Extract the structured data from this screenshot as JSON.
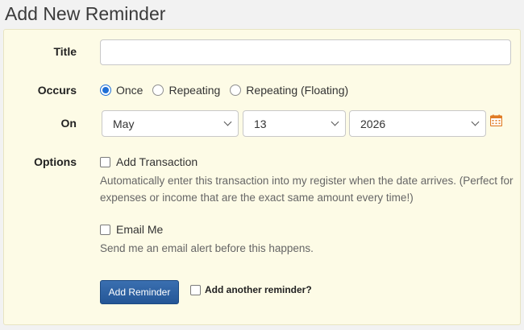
{
  "page": {
    "title": "Add New Reminder"
  },
  "form": {
    "title": {
      "label": "Title",
      "value": "",
      "placeholder": ""
    },
    "occurs": {
      "label": "Occurs",
      "options": [
        "Once",
        "Repeating",
        "Repeating (Floating)"
      ],
      "selected": "Once"
    },
    "on": {
      "label": "On",
      "month": "May",
      "day": "13",
      "year": "2026",
      "calendar_icon": "calendar-icon"
    },
    "options": {
      "label": "Options",
      "add_transaction": {
        "label": "Add Transaction",
        "checked": false,
        "help": "Automatically enter this transaction into my register when the date arrives. (Perfect for expenses or income that are the exact same amount every time!)"
      },
      "email_me": {
        "label": "Email Me",
        "checked": false,
        "help": "Send me an email alert before this happens."
      }
    },
    "submit_label": "Add Reminder",
    "add_another": {
      "label": "Add another reminder?",
      "checked": false
    }
  },
  "colors": {
    "panel_bg": "#fdfbe6",
    "primary_button": "#2d62a3",
    "calendar_icon": "#e07b24",
    "radio_selected": "#1f6fd6"
  }
}
